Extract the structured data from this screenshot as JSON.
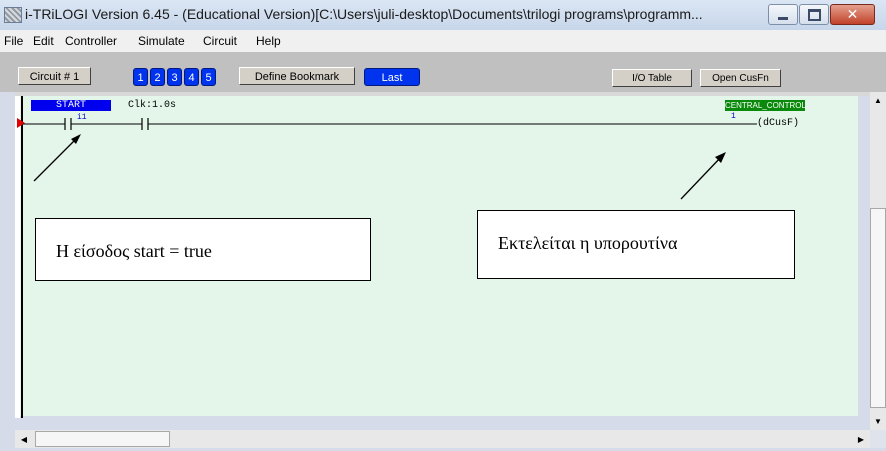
{
  "window": {
    "title": "i-TRiLOGI Version 6.45  - (Educational Version)[C:\\Users\\juli-desktop\\Documents\\trilogi programs\\programm...",
    "icons": {
      "app": "app-icon",
      "minimize": "minimize-icon",
      "maximize": "maximize-icon",
      "close": "close-icon"
    },
    "close_glyph": "✕"
  },
  "menu": {
    "items": [
      "File",
      "Edit",
      "Controller",
      "Simulate",
      "Circuit",
      "Help"
    ]
  },
  "toolbar": {
    "circuit_label": "Circuit # 1",
    "bookmarks": [
      "1",
      "2",
      "3",
      "4",
      "5"
    ],
    "define_bookmark": "Define Bookmark",
    "last": "Last",
    "io_table": "I/O Table",
    "open_cusfn": "Open CusFn",
    "bookmark_color": "#0033ee"
  },
  "ladder": {
    "background": "#e4f6ea",
    "rung1": {
      "input_label": "START",
      "input_id": "i1",
      "timer_label": "Clk:1.0s",
      "output_label": "CENTRAL_CONTROL",
      "output_id": "1",
      "coil_text": "(dCusF)"
    },
    "colors": {
      "input_label_bg": "#0000ee",
      "output_label_bg": "#0a8a0a",
      "marker": "#e00000"
    }
  },
  "annotations": {
    "note1": "Η είσοδος start = true",
    "note2": "Εκτελείται η υπορουτίνα"
  },
  "scrollbars": {
    "up": "▲",
    "down": "▼",
    "left": "◀",
    "right": "▶"
  }
}
